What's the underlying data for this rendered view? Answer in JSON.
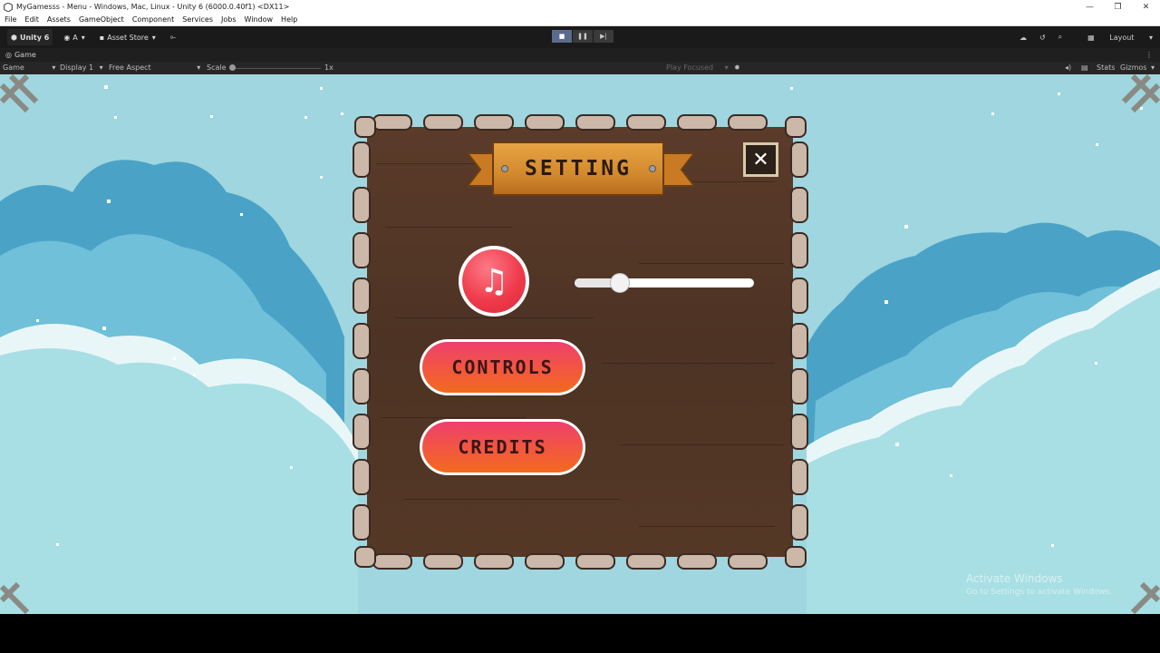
{
  "window": {
    "title": "MyGamesss - Menu - Windows, Mac, Linux - Unity 6 (6000.0.40f1) <DX11>",
    "minimize": "—",
    "restore": "❐",
    "close": "✕"
  },
  "menubar": {
    "items": [
      "File",
      "Edit",
      "Assets",
      "GameObject",
      "Component",
      "Services",
      "Jobs",
      "Window",
      "Help"
    ]
  },
  "toolbar": {
    "unity_label": "Unity 6",
    "account_label": "A",
    "asset_store_label": "Asset Store",
    "layout_label": "Layout"
  },
  "tab": {
    "label": "Game"
  },
  "gamebar": {
    "game_dropdown": "Game",
    "display_dropdown": "Display 1",
    "aspect_dropdown": "Free Aspect",
    "scale_label": "Scale",
    "scale_value": "1x",
    "play_focused": "Play Focused",
    "stats_label": "Stats",
    "gizmos_label": "Gizmos"
  },
  "game": {
    "title": "SETTING",
    "close_glyph": "✕",
    "music_glyph": "♫",
    "volume_slider_value": 0.25,
    "controls_label": "CONTROLS",
    "credits_label": "CREDITS"
  },
  "watermark": {
    "line1": "Activate Windows",
    "line2": "Go to Settings to activate Windows."
  },
  "colors": {
    "sky": "#9fd6df",
    "wood": "#4d3324",
    "banner": "#d38a2e",
    "pill_top": "#ef3f6d",
    "pill_bottom": "#f26a1e",
    "music_red": "#ef3b4c"
  }
}
